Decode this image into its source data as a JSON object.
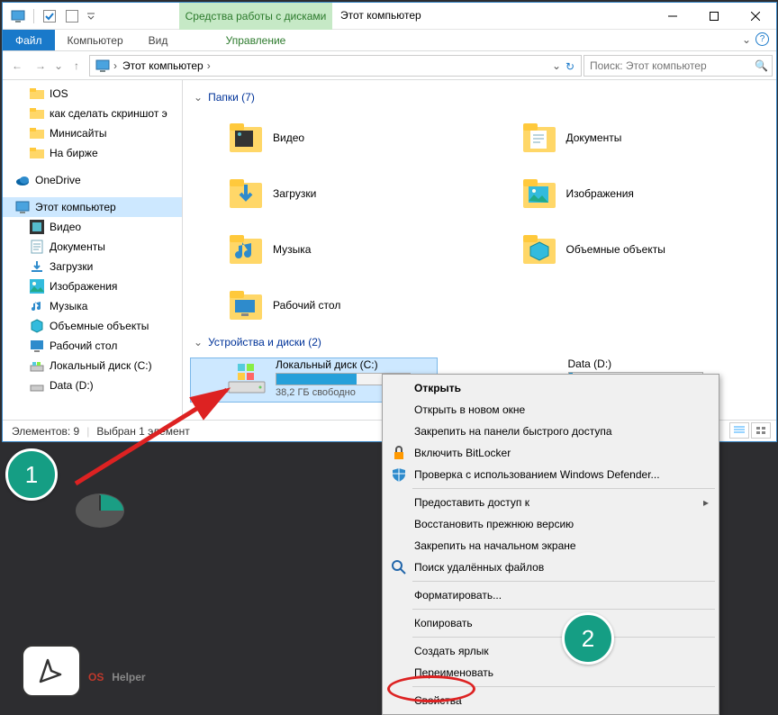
{
  "title": "Этот компьютер",
  "ribbon_contextual": "Средства работы с дисками",
  "ribbon_manage": "Управление",
  "tabs": {
    "file": "Файл",
    "computer": "Компьютер",
    "view": "Вид"
  },
  "address": "Этот компьютер",
  "search_placeholder": "Поиск: Этот компьютер",
  "sidebar": [
    {
      "icon": "folder",
      "label": "IOS"
    },
    {
      "icon": "folder",
      "label": "как сделать скриншот э"
    },
    {
      "icon": "folder",
      "label": "Минисайты"
    },
    {
      "icon": "folder",
      "label": "На бирже"
    }
  ],
  "sidebar_onedrive": "OneDrive",
  "sidebar_thispc": "Этот компьютер",
  "sidebar_pc": [
    {
      "icon": "video",
      "label": "Видео"
    },
    {
      "icon": "docs",
      "label": "Документы"
    },
    {
      "icon": "downloads",
      "label": "Загрузки"
    },
    {
      "icon": "pictures",
      "label": "Изображения"
    },
    {
      "icon": "music",
      "label": "Музыка"
    },
    {
      "icon": "3d",
      "label": "Объемные объекты"
    },
    {
      "icon": "desktop",
      "label": "Рабочий стол"
    },
    {
      "icon": "drive",
      "label": "Локальный диск (C:)"
    },
    {
      "icon": "drive",
      "label": "Data (D:)"
    }
  ],
  "group_folders": "Папки (7)",
  "group_devices": "Устройства и диски (2)",
  "folders": [
    {
      "label": "Видео"
    },
    {
      "label": "Документы"
    },
    {
      "label": "Загрузки"
    },
    {
      "label": "Изображения"
    },
    {
      "label": "Музыка"
    },
    {
      "label": "Объемные объекты"
    },
    {
      "label": "Рабочий стол"
    }
  ],
  "drives": [
    {
      "label": "Локальный диск (C:)",
      "sub": "38,2 ГБ свободно",
      "fill": 60,
      "selected": true
    },
    {
      "label": "Data (D:)",
      "sub": "",
      "fill": 3,
      "selected": false
    }
  ],
  "status_items": "Элементов: 9",
  "status_sel": "Выбран 1 элемент",
  "ctx": [
    {
      "t": "Открыть",
      "bold": true
    },
    {
      "t": "Открыть в новом окне"
    },
    {
      "t": "Закрепить на панели быстрого доступа"
    },
    {
      "t": "Включить BitLocker",
      "ico": "lock"
    },
    {
      "t": "Проверка с использованием Windows Defender...",
      "ico": "shield"
    },
    {
      "sep": true
    },
    {
      "t": "Предоставить доступ к",
      "sub": true
    },
    {
      "t": "Восстановить прежнюю версию"
    },
    {
      "t": "Закрепить на начальном экране"
    },
    {
      "t": "Поиск удалённых файлов",
      "ico": "search"
    },
    {
      "sep": true
    },
    {
      "t": "Форматировать..."
    },
    {
      "sep": true
    },
    {
      "t": "Копировать"
    },
    {
      "sep": true
    },
    {
      "t": "Создать ярлык"
    },
    {
      "t": "Переименовать"
    },
    {
      "sep": true
    },
    {
      "t": "Свойства"
    }
  ],
  "badge1": "1",
  "badge2": "2",
  "logo_os": "OS",
  "logo_helper": "Helper"
}
